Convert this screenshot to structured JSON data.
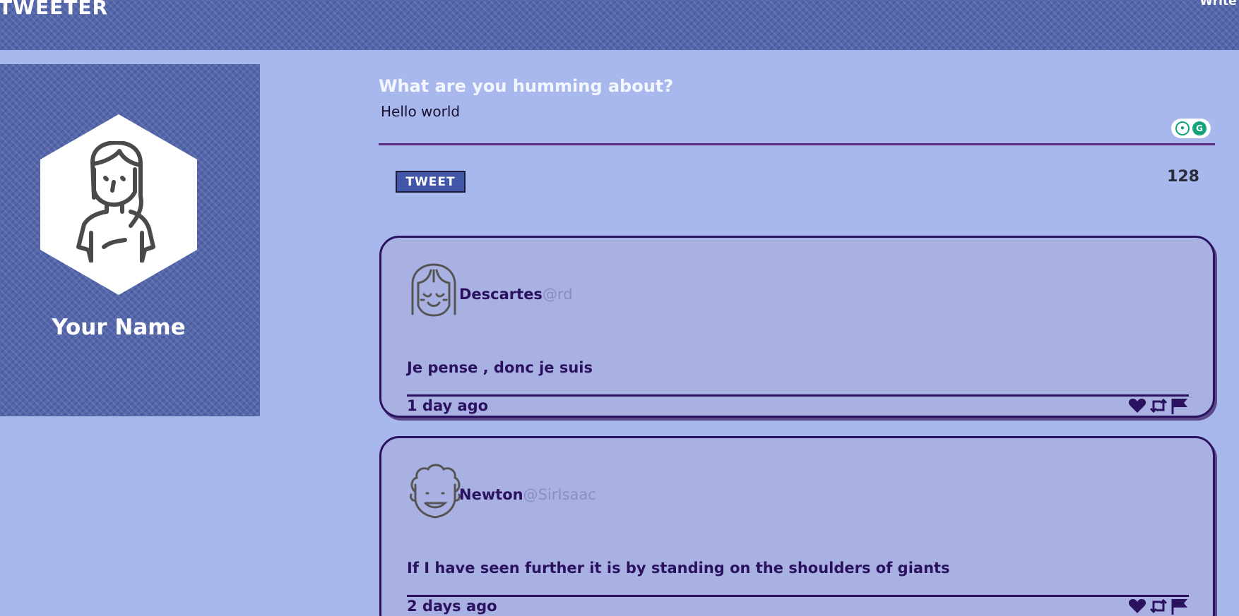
{
  "nav": {
    "brand": "TWEETER",
    "write_link": "Write a"
  },
  "profile": {
    "name": "Your Name",
    "avatar": "woman-avatar-icon"
  },
  "compose": {
    "heading": "What are you humming about?",
    "value": "Hello world",
    "button_label": "TWEET",
    "counter": "128"
  },
  "tweets": [
    {
      "name": "Descartes",
      "handle": "@rd",
      "text": "Je pense , donc je suis",
      "time": "1 day ago",
      "avatar": "girl-avatar-icon"
    },
    {
      "name": "Newton",
      "handle": "@SirIsaac",
      "text": "If I have seen further it is by standing on the shoulders of giants",
      "time": "2 days ago",
      "avatar": "curly-hair-avatar-icon"
    }
  ],
  "icons": [
    "heart-icon",
    "retweet-icon",
    "flag-icon"
  ],
  "colors": {
    "background": "#a8b8ec",
    "nav": "#5567ab",
    "accent": "#2b1260",
    "button": "#4256a8"
  }
}
